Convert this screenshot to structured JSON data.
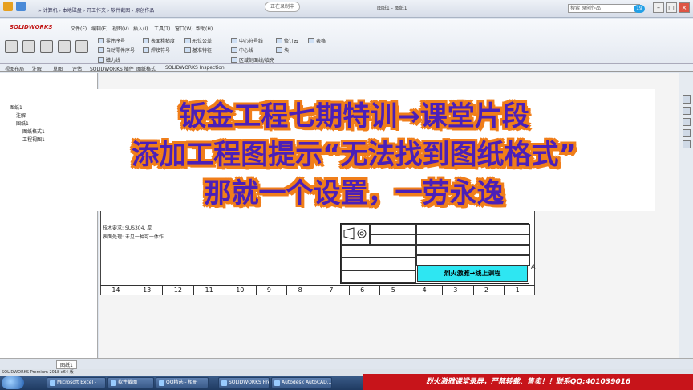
{
  "window": {
    "crumbs": "» 计算机 › 本地磁盘 › 开工作夹 › 软件截图 › 原创作品",
    "rec_label": "正在录制中",
    "sw_title": "图纸1 - 图纸1",
    "search_placeholder": "搜索 原创作品",
    "badge": "19"
  },
  "ribbon": {
    "logo": "SOLIDWORKS",
    "menu": [
      "文件(F)",
      "编辑(E)",
      "视图(V)",
      "插入(I)",
      "工具(T)",
      "窗口(W)",
      "帮助(H)"
    ],
    "buttons": [
      "零件序号",
      "自动零件序号",
      "磁力线",
      "表面粗糙度",
      "焊接符号",
      "形位公差",
      "基准特征",
      "中心符号线",
      "中心线",
      "区域剖面线/填充",
      "修订云",
      "块",
      "表格"
    ],
    "tabs": [
      "视图布局",
      "注解",
      "草图",
      "评估",
      "SOLIDWORKS 插件",
      "图纸格式",
      "SOLIDWORKS Inspection"
    ]
  },
  "tree": {
    "items": [
      "图纸1",
      "注解",
      "图纸1",
      "图纸格式1",
      "工程视图1"
    ]
  },
  "drawing": {
    "material_note": "技术要求:  SUS304, 厚",
    "surface_note": "表面处理:  未见一种可一体作.",
    "cyan_label": "烈火激雅→线上课程",
    "ruler": [
      "14",
      "13",
      "12",
      "11",
      "10",
      "9",
      "8",
      "7",
      "6",
      "5",
      "4",
      "3",
      "2",
      "1"
    ],
    "zone_letter": "A"
  },
  "overlay": {
    "line1": "钣金工程七期特训→课堂片段",
    "line2": "添加工程图提示“无法找到图纸格式”",
    "line3": "那就一个设置，一劳永逸"
  },
  "bottom": {
    "sheet_tab": "图纸1",
    "status": "SOLIDWORKS Premium 2018 x64 版",
    "tasks": [
      "Microsoft Excel -",
      "软件截图",
      "QQ精选 - 相册",
      "SOLIDWORKS Pre...",
      "Autodesk AutoCAD..."
    ],
    "notice": "烈火激雅课堂录屏，严禁转载、售卖！！联系QQ:401039016"
  },
  "colors": {
    "overlay_text": "#4b1fb8",
    "overlay_outline": "#f07e1a",
    "notice_bg": "#c7141a",
    "cyan_cell": "#2ee6f2"
  }
}
